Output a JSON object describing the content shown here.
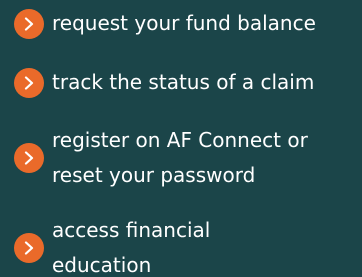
{
  "links": [
    {
      "label": "request your fund balance",
      "icon": "chevron-right-icon"
    },
    {
      "label": "track the status of a claim",
      "icon": "chevron-right-icon"
    },
    {
      "label_lines": [
        "register on AF Connect or",
        "reset your password"
      ],
      "icon": "chevron-right-icon"
    },
    {
      "label_lines": [
        "access financial",
        "education"
      ],
      "icon": "chevron-right-icon"
    }
  ],
  "colors": {
    "background": "#1b4549",
    "accent": "#ea6a2a",
    "text": "#ffffff"
  }
}
